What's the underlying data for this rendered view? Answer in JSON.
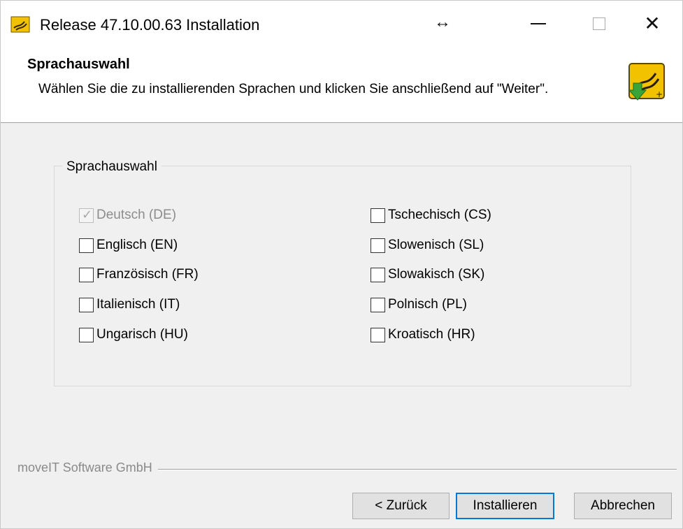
{
  "window": {
    "title": "Release 47.10.00.63 Installation",
    "resize_glyph": "↔",
    "close_glyph": "✕",
    "icons": [
      "app-logo-icon",
      "resize-icon",
      "minimize-icon",
      "maximize-icon",
      "close-icon"
    ]
  },
  "header": {
    "title": "Sprachauswahl",
    "subtitle": "Wählen Sie die zu installierenden Sprachen und klicken Sie anschließend auf \"Weiter\".",
    "icon": "installer-icon"
  },
  "group": {
    "label": "Sprachauswahl",
    "left_column": [
      {
        "label": "Deutsch (DE)",
        "checked": true,
        "disabled": true
      },
      {
        "label": "Englisch (EN)",
        "checked": false,
        "disabled": false
      },
      {
        "label": "Französisch (FR)",
        "checked": false,
        "disabled": false
      },
      {
        "label": "Italienisch (IT)",
        "checked": false,
        "disabled": false
      },
      {
        "label": "Ungarisch (HU)",
        "checked": false,
        "disabled": false
      }
    ],
    "right_column": [
      {
        "label": "Tschechisch (CS)",
        "checked": false,
        "disabled": false
      },
      {
        "label": "Slowenisch (SL)",
        "checked": false,
        "disabled": false
      },
      {
        "label": "Slowakisch (SK)",
        "checked": false,
        "disabled": false
      },
      {
        "label": "Polnisch (PL)",
        "checked": false,
        "disabled": false
      },
      {
        "label": "Kroatisch (HR)",
        "checked": false,
        "disabled": false
      }
    ]
  },
  "footer": {
    "brand": "moveIT Software GmbH",
    "buttons": {
      "back": "< Zurück",
      "install": "Installieren",
      "cancel": "Abbrechen"
    }
  },
  "colors": {
    "accent": "#0078d7",
    "dialog_background": "#f0f0f0",
    "logo_yellow": "#f2c200",
    "logo_green": "#3aa43a"
  }
}
